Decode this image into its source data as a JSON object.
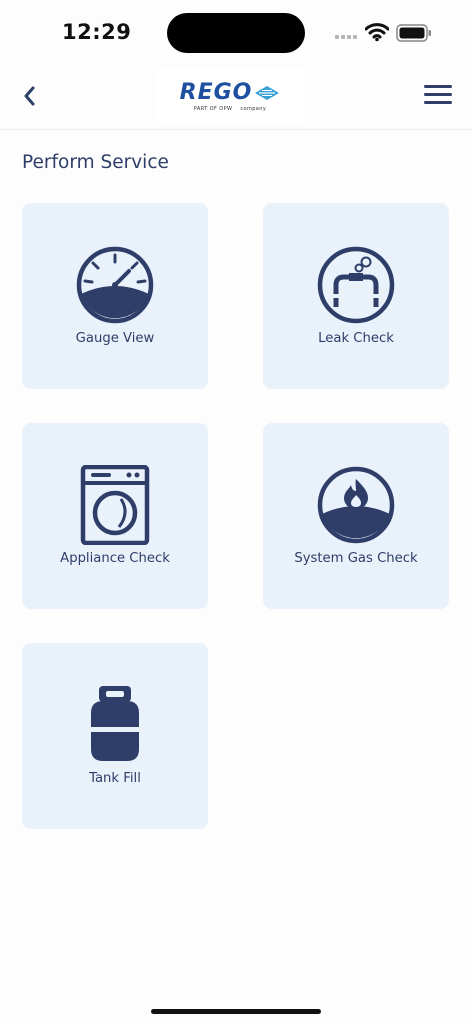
{
  "status_bar": {
    "time": "12:29",
    "signal_icon": "cellular-signal-icon",
    "wifi_icon": "wifi-icon",
    "battery_icon": "battery-icon"
  },
  "nav": {
    "back_icon": "chevron-left-icon",
    "logo": {
      "word": "REGO",
      "tagline_left": "PART OF OPW",
      "tagline_right": "company"
    },
    "menu_icon": "hamburger-menu-icon"
  },
  "main": {
    "title": "Perform Service",
    "tiles": [
      {
        "label": "Gauge View",
        "icon": "gauge-icon"
      },
      {
        "label": "Leak Check",
        "icon": "leak-check-icon"
      },
      {
        "label": "Appliance Check",
        "icon": "appliance-icon"
      },
      {
        "label": "System Gas Check",
        "icon": "gas-flame-icon"
      },
      {
        "label": "Tank Fill",
        "icon": "propane-tank-icon"
      }
    ]
  },
  "colors": {
    "primary": "#2e3e68",
    "tile_bg": "#e9f1fb",
    "logo_blue": "#1f4fa0",
    "background": "#fdfdfd"
  }
}
